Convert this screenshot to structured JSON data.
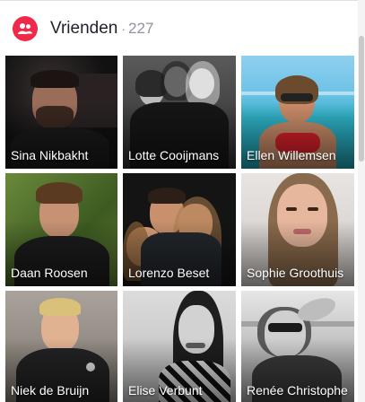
{
  "section": {
    "title": "Vrienden",
    "separator": "·",
    "count": "227",
    "icon": "friends-icon",
    "accent": "#f02849"
  },
  "friends": [
    {
      "name": "Sina Nikbakht"
    },
    {
      "name": "Lotte Cooijmans"
    },
    {
      "name": "Ellen Willemsen"
    },
    {
      "name": "Daan Roosen"
    },
    {
      "name": "Lorenzo Beset"
    },
    {
      "name": "Sophie Groothuis"
    },
    {
      "name": "Niek de Bruijn"
    },
    {
      "name": "Elise Verbunt"
    },
    {
      "name": "Renée Christophe"
    }
  ]
}
